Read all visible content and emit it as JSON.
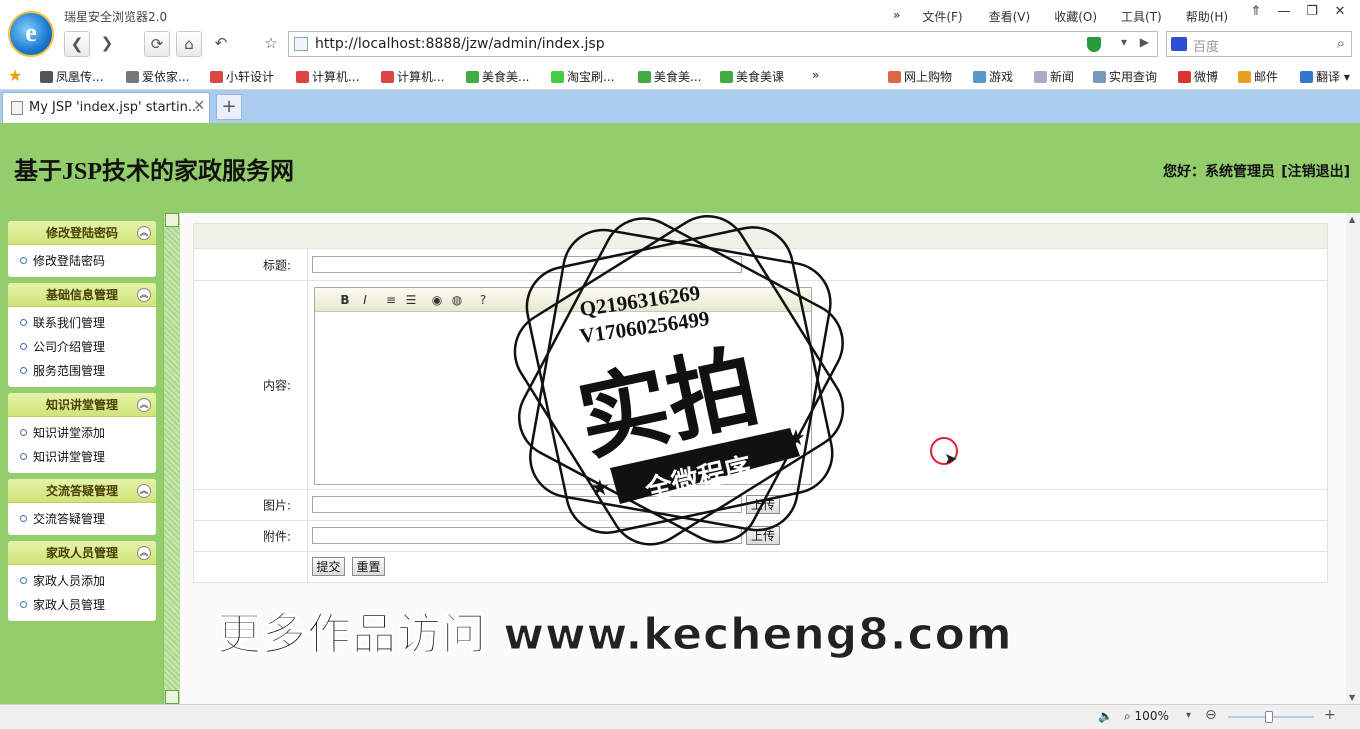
{
  "browser": {
    "title": "瑞星安全浏览器2.0",
    "menu": [
      "»",
      "文件(F)",
      "查看(V)",
      "收藏(O)",
      "工具(T)",
      "帮助(H)"
    ],
    "window_controls": [
      "⇑",
      "—",
      "❐",
      "✕"
    ],
    "url": "http://localhost:8888/jzw/admin/index.jsp",
    "search_placeholder": "百度",
    "favorites": [
      "凤凰传...",
      "爱依家...",
      "小轩设计",
      "计算机...",
      "计算机...",
      "美食美...",
      "淘宝刷...",
      "美食美...",
      "美食美课",
      "»",
      "网上购物",
      "游戏",
      "新闻",
      "实用查询",
      "微博",
      "邮件",
      "翻译"
    ],
    "tab_title": "My JSP 'index.jsp' startin...",
    "new_tab": "+",
    "zoom": "100%"
  },
  "site": {
    "title": "基于JSP技术的家政服务网",
    "greeting": "您好：系统管理员",
    "logout": "[注销退出]"
  },
  "sidebar": {
    "groups": [
      {
        "title": "修改登陆密码",
        "items": [
          "修改登陆密码"
        ]
      },
      {
        "title": "基础信息管理",
        "items": [
          "联系我们管理",
          "公司介绍管理",
          "服务范围管理"
        ]
      },
      {
        "title": "知识讲堂管理",
        "items": [
          "知识讲堂添加",
          "知识讲堂管理"
        ]
      },
      {
        "title": "交流答疑管理",
        "items": [
          "交流答疑管理"
        ]
      },
      {
        "title": "家政人员管理",
        "items": [
          "家政人员添加",
          "家政人员管理"
        ]
      }
    ]
  },
  "form": {
    "title_label": "标题:",
    "content_label": "内容:",
    "image_label": "图片:",
    "attach_label": "附件:",
    "upload": "上传",
    "submit": "提交",
    "reset": "重置",
    "editor_tools": [
      "B",
      "I",
      "≡",
      "☰",
      "◉",
      "◍",
      "?"
    ]
  },
  "watermark": {
    "stamp_line1": "Q2196316269",
    "stamp_line2": "V17060256499",
    "stamp_big": "实拍",
    "stamp_ribbon": "全微程序",
    "footer_text": "更多作品访问 www.kecheng8.com"
  }
}
